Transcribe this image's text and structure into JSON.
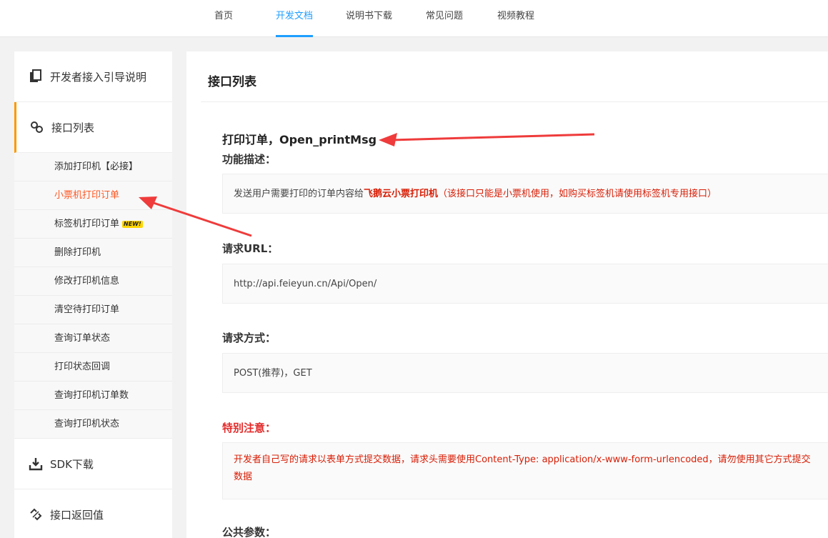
{
  "nav": {
    "items": [
      {
        "label": "首页"
      },
      {
        "label": "开发文档"
      },
      {
        "label": "说明书下载"
      },
      {
        "label": "常见问题"
      },
      {
        "label": "视频教程"
      }
    ]
  },
  "sidebar": {
    "guide": "开发者接入引导说明",
    "api_list": "接口列表",
    "sub_items": [
      {
        "label": "添加打印机【必接】"
      },
      {
        "label": "小票机打印订单"
      },
      {
        "label": "标签机打印订单",
        "badge": "NEW!"
      },
      {
        "label": "删除打印机"
      },
      {
        "label": "修改打印机信息"
      },
      {
        "label": "清空待打印订单"
      },
      {
        "label": "查询订单状态"
      },
      {
        "label": "打印状态回调"
      },
      {
        "label": "查询打印机订单数"
      },
      {
        "label": "查询打印机状态"
      }
    ],
    "sdk": "SDK下载",
    "return_values": "接口返回值"
  },
  "main": {
    "title": "接口列表",
    "api_name": "打印订单，Open_printMsg",
    "desc_label": "功能描述：",
    "desc_text_pre": "发送用户需要打印的订单内容给",
    "desc_highlight": "飞鹅云小票打印机",
    "desc_text_post": "（该接口只能是小票机使用，如购买标签机请使用标签机专用接口）",
    "url_label": "请求URL：",
    "url_value": "http://api.feieyun.cn/Api/Open/",
    "method_label": "请求方式：",
    "method_value": "POST(推荐)，GET",
    "notice_label": "特别注意：",
    "notice_text": "开发者自己写的请求以表单方式提交数据，请求头需要使用Content-Type: application/x-www-form-urlencoded，请勿使用其它方式提交数据",
    "params_label": "公共参数："
  }
}
